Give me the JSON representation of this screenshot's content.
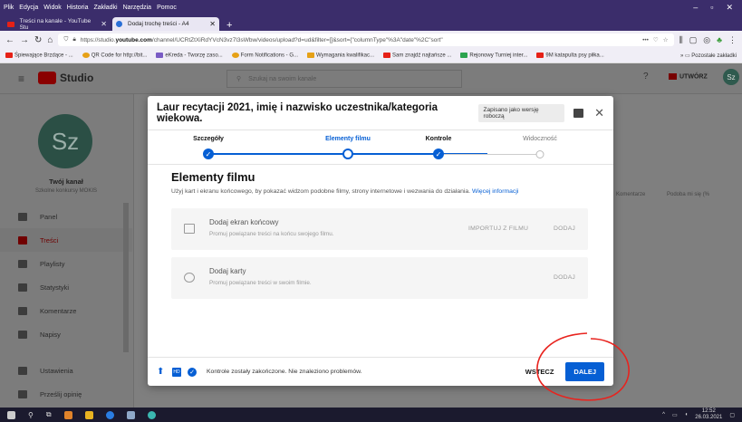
{
  "menubar": {
    "items": [
      "Plik",
      "Edycja",
      "Widok",
      "Historia",
      "Zakładki",
      "Narzędzia",
      "Pomoc"
    ]
  },
  "tabs": [
    {
      "label": "Treści na kanale - YouTube Stu"
    },
    {
      "label": "Dodaj trochę treści - A4"
    }
  ],
  "nav": {
    "url_prefix": "https://studio.",
    "url_domain": "youtube.com",
    "url_rest": "/channel/UCRtZtXiRdYVcN3vz7l3sWbw/videos/upload?d=ud&filter=[]&sort={\"columnType\"%3A\"date\"%2C\"sort\"",
    "more": "•••"
  },
  "bookmarks": {
    "items": [
      "Śpiewające Brzdące - ...",
      "QR Code for http://bit...",
      "eKreda - Tworzę zaso...",
      "Form Notifications - G...",
      "Wymagania kwalifikac...",
      "Sam znajdź najtańsze ...",
      "Rejonowy Turniej inter...",
      "9M katapulta psy piłka..."
    ],
    "overflow": "Pozostałe zakładki"
  },
  "studio": {
    "logo": "Studio",
    "search_placeholder": "Szukaj na swoim kanale",
    "create_label": "UTWÓRZ",
    "avatar": "Sz",
    "channel_name": "Twój kanał",
    "channel_sub": "Szkolne konkursy MOKIS",
    "col_comments": "Komentarze",
    "col_likes": "Podoba mi się (%"
  },
  "sidebar": {
    "items": [
      {
        "label": "Panel"
      },
      {
        "label": "Treści"
      },
      {
        "label": "Playlisty"
      },
      {
        "label": "Statystyki"
      },
      {
        "label": "Komentarze"
      },
      {
        "label": "Napisy"
      },
      {
        "label": "Ustawienia"
      },
      {
        "label": "Prześlij opinię"
      }
    ]
  },
  "modal": {
    "title": "Laur recytacji 2021, imię i nazwisko uczestnika/kategoria wiekowa.",
    "saved": "Zapisano jako wersję roboczą",
    "steps": [
      {
        "label": "Szczegóły",
        "state": "done"
      },
      {
        "label": "Elementy filmu",
        "state": "current"
      },
      {
        "label": "Kontrole",
        "state": "done"
      },
      {
        "label": "Widoczność",
        "state": "todo"
      }
    ],
    "section_title": "Elementy filmu",
    "section_desc": "Użyj kart i ekranu końcowego, by pokazać widzom podobne filmy, strony internetowe i wezwania do działania.",
    "learn_more": "Więcej informacji",
    "cards": [
      {
        "title": "Dodaj ekran końcowy",
        "desc": "Promuj powiązane treści na końcu swojego filmu.",
        "import": "IMPORTUJ Z FILMU",
        "add": "DODAJ"
      },
      {
        "title": "Dodaj karty",
        "desc": "Promuj powiązane treści w swoim filmie.",
        "add": "DODAJ"
      }
    ],
    "status": "Kontrole zostały zakończone. Nie znaleziono problemów.",
    "back": "WSTECZ",
    "next": "DALEJ",
    "hd_badge": "HD"
  },
  "taskbar": {
    "time": "12:52",
    "date": "26.03.2021"
  },
  "colors": {
    "accent": "#065fd4",
    "annotation": "#e8231e",
    "studio_red": "#cc0000"
  }
}
